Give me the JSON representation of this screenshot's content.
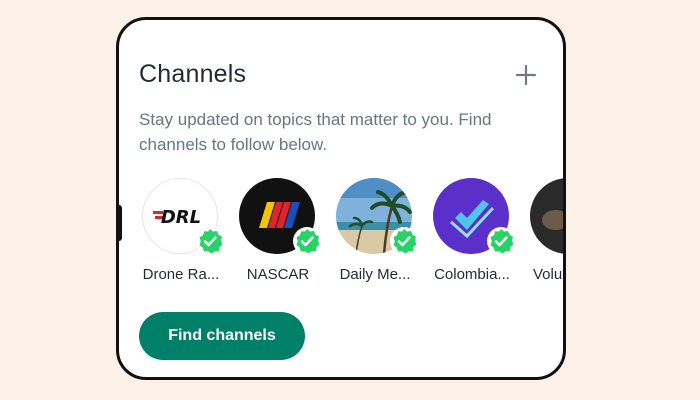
{
  "card": {
    "title": "Channels",
    "add_icon": "plus-icon",
    "description": "Stay updated on topics that matter to you. Find channels to follow below.",
    "find_button": "Find channels"
  },
  "channels": [
    {
      "name": "Drone Ra...",
      "logo_text": "DRL",
      "verified": true
    },
    {
      "name": "NASCAR",
      "verified": true
    },
    {
      "name": "Daily Me...",
      "verified": true
    },
    {
      "name": "Colombia...",
      "verified": true
    },
    {
      "name": "Volun",
      "verified": false
    }
  ],
  "colors": {
    "accent": "#008069",
    "verified_badge": "#25d366",
    "background": "#fbf1e8"
  }
}
